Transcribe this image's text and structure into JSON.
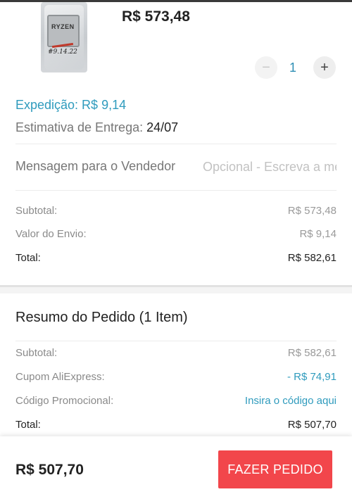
{
  "product": {
    "price": "R$ 573,48",
    "quantity": "1",
    "thumb_chip_label": "RYZEN",
    "thumb_scribble": "#9.14.22"
  },
  "shipping": {
    "label": "Expedição: R$ 9,14",
    "delivery_label": "Estimativa de Entrega: ",
    "delivery_date": "24/07"
  },
  "message": {
    "label": "Mensagem para o Vendedor",
    "placeholder": "Opcional - Escreva a mensagem"
  },
  "store_totals": [
    {
      "label": "Subtotal:",
      "value": "R$ 573,48"
    },
    {
      "label": "Valor do Envio:",
      "value": "R$ 9,14"
    },
    {
      "label": "Total:",
      "value": "R$ 582,61"
    }
  ],
  "summary": {
    "title": "Resumo do Pedido (1 Item)",
    "rows": [
      {
        "label": "Subtotal:",
        "value": "R$ 582,61"
      },
      {
        "label": "Cupom AliExpress:",
        "value": "- R$ 74,91"
      },
      {
        "label": "Código Promocional:",
        "value": "Insira o código aqui"
      },
      {
        "label": "Total:",
        "value": "R$ 507,70"
      }
    ]
  },
  "footer": {
    "total": "R$ 507,70",
    "order_button": "FAZER PEDIDO"
  },
  "colors": {
    "accent_blue": "#2f9bbd",
    "order_red": "#f2464b"
  }
}
